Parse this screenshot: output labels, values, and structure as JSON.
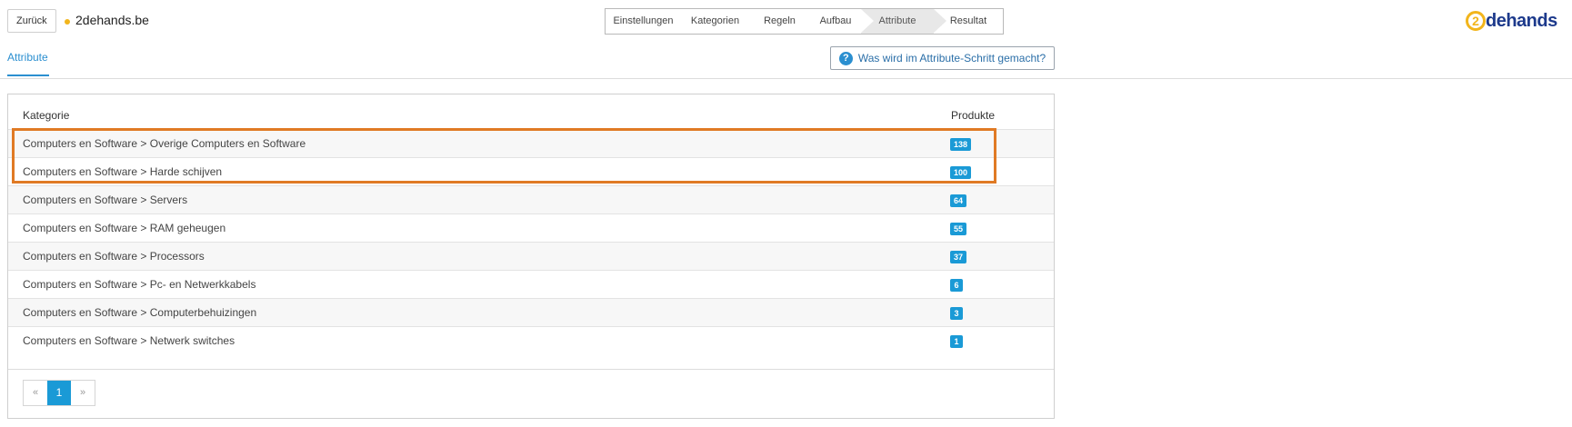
{
  "header": {
    "back_label": "Zurück",
    "shop_name": "2dehands.be",
    "status_color": "#f2b51c",
    "logo": {
      "mark": "2",
      "text": "dehands"
    }
  },
  "wizard": {
    "steps": [
      {
        "label": "Einstellungen",
        "active": false
      },
      {
        "label": "Kategorien",
        "active": false
      },
      {
        "label": "Regeln",
        "active": false
      },
      {
        "label": "Aufbau",
        "active": false
      },
      {
        "label": "Attribute",
        "active": true
      },
      {
        "label": "Resultat",
        "active": false
      }
    ]
  },
  "tabs": {
    "active_label": "Attribute"
  },
  "help": {
    "icon": "question-circle-icon",
    "label": "Was wird im Attribute-Schritt gemacht?"
  },
  "table": {
    "headers": {
      "category": "Kategorie",
      "products": "Produkte"
    },
    "rows": [
      {
        "category": "Computers en Software > Overige Computers en Software",
        "count": "138"
      },
      {
        "category": "Computers en Software > Harde schijven",
        "count": "100"
      },
      {
        "category": "Computers en Software > Servers",
        "count": "64"
      },
      {
        "category": "Computers en Software > RAM geheugen",
        "count": "55"
      },
      {
        "category": "Computers en Software > Processors",
        "count": "37"
      },
      {
        "category": "Computers en Software > Pc- en Netwerkkabels",
        "count": "6"
      },
      {
        "category": "Computers en Software > Computerbehuizingen",
        "count": "3"
      },
      {
        "category": "Computers en Software > Netwerk switches",
        "count": "1"
      }
    ]
  },
  "pagination": {
    "prev": "«",
    "current": "1",
    "next": "»"
  },
  "colors": {
    "accent": "#1a9ad6",
    "highlight": "#e07a24"
  }
}
